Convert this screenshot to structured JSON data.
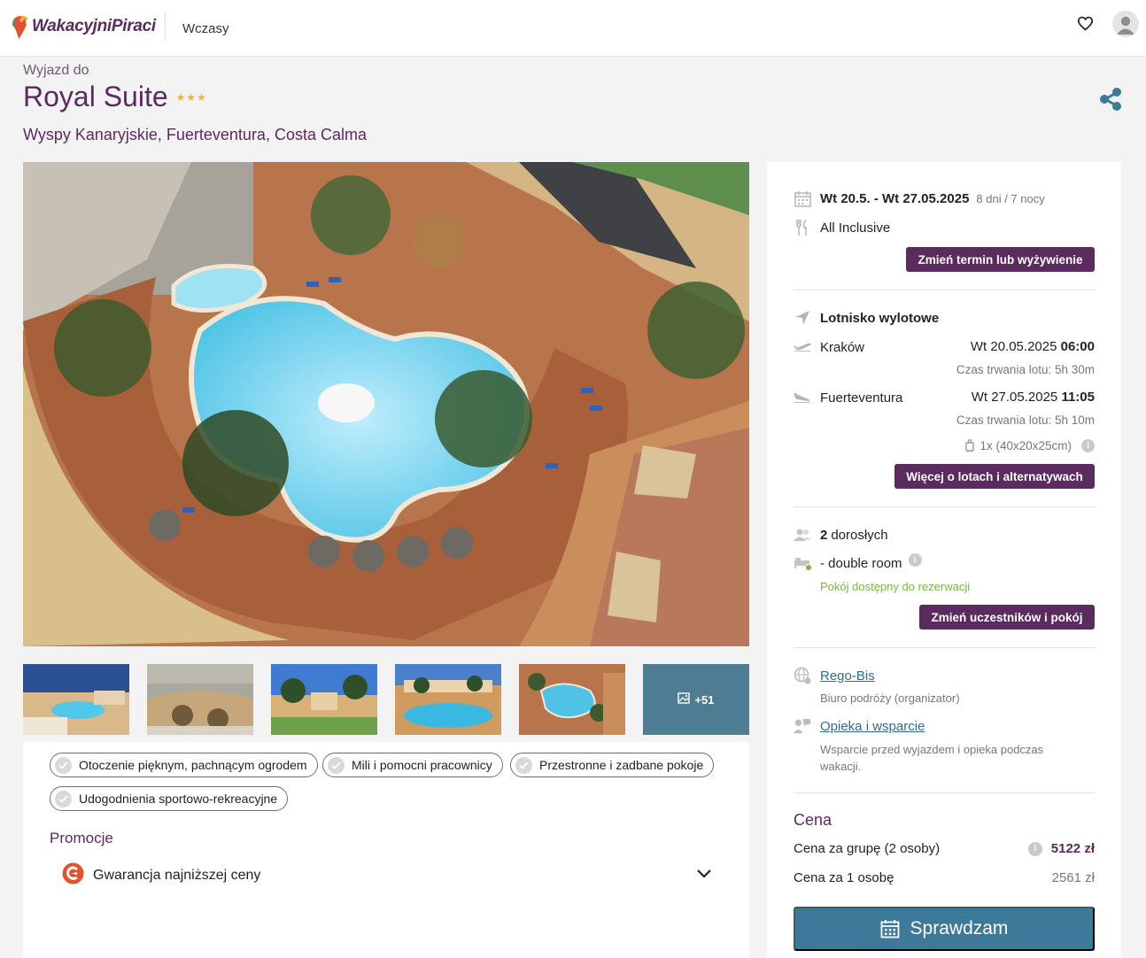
{
  "header": {
    "logo_text": "WakacyjniPiraci",
    "nav_label": "Wczasy",
    "icons": [
      "heart-icon",
      "user-icon"
    ]
  },
  "hotel": {
    "lead": "Wyjazd do",
    "name": "Royal Suite",
    "stars": 3,
    "stars_text": "★★★",
    "location": "Wyspy Kanaryjskie, Fuerteventura, Costa Calma"
  },
  "gallery": {
    "more_label": "+51",
    "thumb_count": 5
  },
  "tags": [
    "Otoczenie pięknym, pachnącym ogrodem",
    "Mili i pomocni pracownicy",
    "Przestronne i zadbane pokoje",
    "Udogodnienia sportowo-rekreacyjne"
  ],
  "promotions": {
    "title": "Promocje",
    "items": [
      "Gwarancja najniższej ceny"
    ]
  },
  "booking": {
    "dates": "Wt 20.5. - Wt 27.05.2025",
    "duration": "8 dni / 7 nocy",
    "board": "All Inclusive",
    "change_dates_btn": "Zmień termin lub wyżywienie",
    "airport_title": "Lotnisko wylotowe",
    "outbound": {
      "city": "Kraków",
      "date": "Wt 20.05.2025",
      "time": "06:00",
      "duration": "Czas trwania lotu: 5h 30m"
    },
    "inbound": {
      "city": "Fuerteventura",
      "date": "Wt 27.05.2025",
      "time": "11:05",
      "duration": "Czas trwania lotu: 5h 10m"
    },
    "luggage": "1x (40x20x25cm)",
    "flights_btn": "Więcej o lotach i alternatywach",
    "adults_count": "2",
    "adults_label": "dorosłych",
    "room": "- double room",
    "room_status": "Pokój dostępny do rezerwacji",
    "change_room_btn": "Zmień uczestników i pokój",
    "organizer_link": "Rego-Bis",
    "organizer_desc": "Biuro podróży (organizator)",
    "support_link": "Opieka i wsparcie",
    "support_desc": "Wsparcie przed wyjazdem i opieka podczas wakacji.",
    "price_title": "Cena",
    "group_price_label": "Cena za grupę (2 osoby)",
    "group_price": "5122 zł",
    "person_price_label": "Cena za 1 osobę",
    "person_price": "2561 zł",
    "cta_label": "Sprawdzam"
  },
  "colors": {
    "brand_purple": "#5b2a5e",
    "cta_blue": "#3d7a9a",
    "link_blue": "#2e6d8e",
    "available_green": "#7cb342",
    "star_gold": "#f4b321"
  }
}
